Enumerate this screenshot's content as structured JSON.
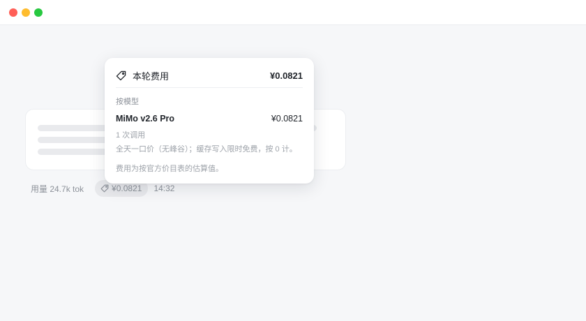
{
  "window": {
    "controls": [
      "close",
      "minimize",
      "maximize"
    ]
  },
  "meta": {
    "usage": "用量 24.7k tok",
    "cost_chip": "¥0.0821",
    "time": "14:32"
  },
  "cost_popover": {
    "title": "本轮费用",
    "total": "¥0.0821",
    "section_label": "按模型",
    "models": [
      {
        "name": "MiMo v2.6 Pro",
        "cost": "¥0.0821",
        "calls": "1 次调用",
        "pricing_note": "全天一口价（无峰谷）；缓存写入限时免费，按 0 计。"
      }
    ],
    "footnote": "费用为按官方价目表的估算值。"
  },
  "icons": {
    "tag": "tag-icon"
  },
  "colors": {
    "close": "#ff5f57",
    "minimize": "#febc2e",
    "maximize": "#28c840"
  }
}
